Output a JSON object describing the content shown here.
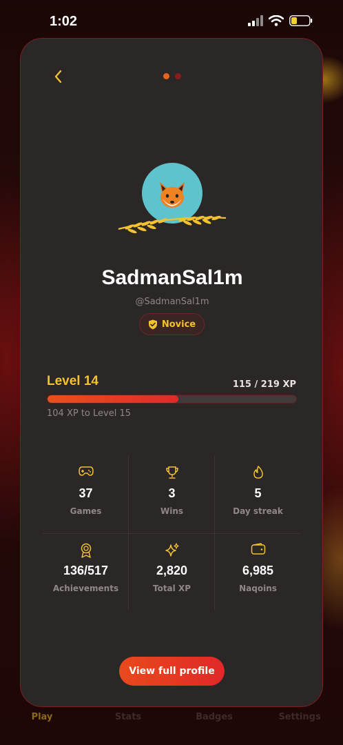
{
  "status_bar": {
    "time": "1:02"
  },
  "pager": {
    "active_color": "#e8641c",
    "inactive_color": "#8a1c1c"
  },
  "profile": {
    "username": "SadmanSal1m",
    "handle": "@SadmanSal1m",
    "rank": "Novice",
    "avatar_emoji": "🦊",
    "avatar_bg": "#5ec3cc"
  },
  "level": {
    "title": "Level 14",
    "xp_text": "115 / 219 XP",
    "progress_fraction": 0.525,
    "to_next_text": "104 XP to Level 15"
  },
  "stats": [
    {
      "icon": "gamepad-icon",
      "value": "37",
      "label": "Games"
    },
    {
      "icon": "trophy-icon",
      "value": "3",
      "label": "Wins"
    },
    {
      "icon": "flame-icon",
      "value": "5",
      "label": "Day streak"
    },
    {
      "icon": "medal-icon",
      "value": "136/517",
      "label": "Achievements"
    },
    {
      "icon": "sparkles-icon",
      "value": "2,820",
      "label": "Total XP"
    },
    {
      "icon": "wallet-icon",
      "value": "6,985",
      "label": "Naqoins"
    }
  ],
  "cta": {
    "label": "View full profile"
  },
  "bottom_nav": [
    {
      "label": "Play",
      "active": true
    },
    {
      "label": "Stats",
      "active": false
    },
    {
      "label": "Badges",
      "active": false
    },
    {
      "label": "Settings",
      "active": false
    }
  ],
  "colors": {
    "accent": "#f2c230",
    "brand": "#e8501c",
    "sheet_bg": "#2b2727"
  }
}
